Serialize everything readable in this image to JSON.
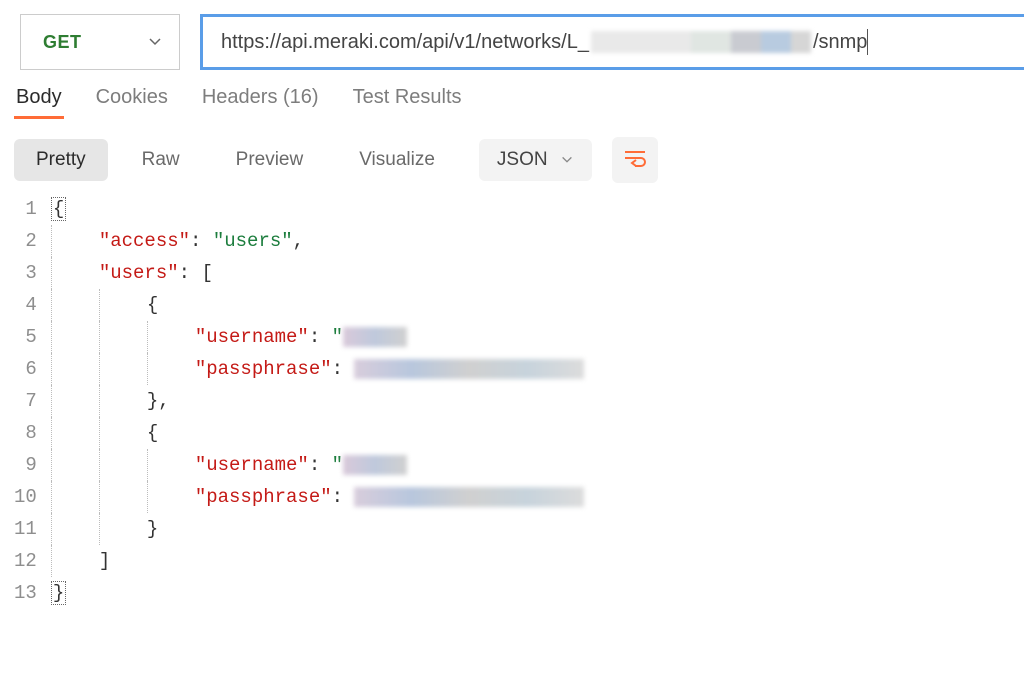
{
  "request": {
    "method": "GET",
    "url_prefix": "https://api.meraki.com/api/v1/networks/L_",
    "url_suffix": "/snmp"
  },
  "responseTabs": {
    "body": "Body",
    "cookies": "Cookies",
    "headers": "Headers (16)",
    "testResults": "Test Results"
  },
  "bodyToolbar": {
    "pretty": "Pretty",
    "raw": "Raw",
    "preview": "Preview",
    "visualize": "Visualize",
    "format": "JSON"
  },
  "code": {
    "lineNumbers": [
      "1",
      "2",
      "3",
      "4",
      "5",
      "6",
      "7",
      "8",
      "9",
      "10",
      "11",
      "12",
      "13"
    ],
    "keys": {
      "access": "\"access\"",
      "users": "\"users\"",
      "username": "\"username\"",
      "passphrase": "\"passphrase\""
    },
    "values": {
      "access": "\"users\""
    },
    "punc": {
      "colon": ": ",
      "comma": ",",
      "lbracket": "[",
      "rbracket": "]",
      "lbrace": "{",
      "rbrace": "}",
      "quote": "\""
    }
  }
}
